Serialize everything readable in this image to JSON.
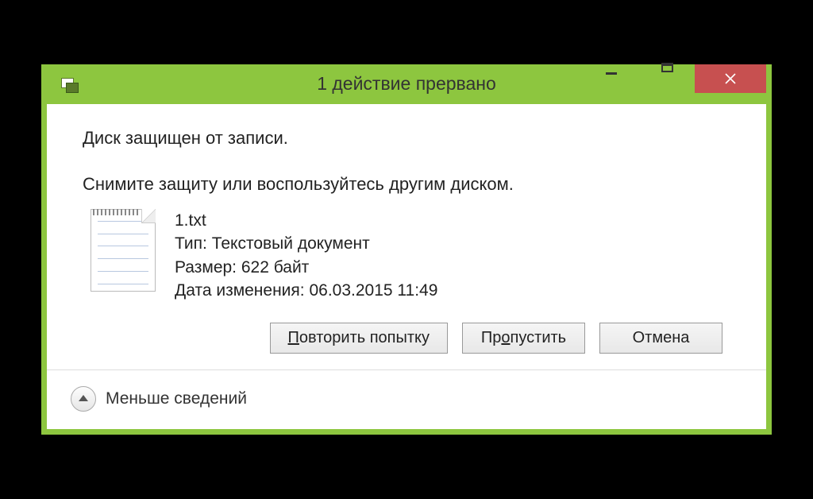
{
  "titlebar": {
    "title": "1 действие прервано"
  },
  "content": {
    "heading": "Диск защищен от записи.",
    "instruction": "Снимите защиту или воспользуйтесь другим диском."
  },
  "file": {
    "name": "1.txt",
    "type_label": "Тип: ",
    "type_value": "Текстовый документ",
    "size_label": "Размер: ",
    "size_value": "622 байт",
    "modified_label": "Дата изменения: ",
    "modified_value": "06.03.2015 11:49"
  },
  "buttons": {
    "retry": "Повторить попытку",
    "skip": "Пропустить",
    "cancel": "Отмена"
  },
  "footer": {
    "less_details": "Меньше сведений"
  }
}
